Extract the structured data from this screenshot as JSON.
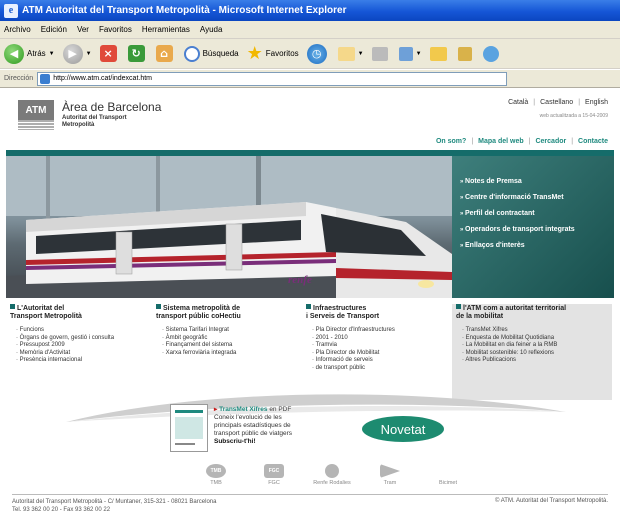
{
  "window": {
    "title": "ATM Autoritat del Transport Metropolità - Microsoft Internet Explorer"
  },
  "menu": [
    "Archivo",
    "Edición",
    "Ver",
    "Favoritos",
    "Herramientas",
    "Ayuda"
  ],
  "toolbar": {
    "back_label": "Atrás",
    "search_label": "Búsqueda",
    "favorites_label": "Favoritos"
  },
  "address": {
    "label": "Dirección",
    "url": "http://www.atm.cat/indexcat.htm"
  },
  "header": {
    "logo": "ATM",
    "title": "Àrea de Barcelona",
    "subtitle_line1": "Autoritat del Transport",
    "subtitle_line2": "Metropolità",
    "languages": [
      "Català",
      "Castellano",
      "English"
    ],
    "updated": "web actualitzada a 15-04-2009",
    "nav": [
      "On som?",
      "Mapa del web",
      "Cercador",
      "Contacte"
    ]
  },
  "hero": {
    "train_brand": "renfe",
    "links": [
      "Notes de Premsa",
      "Centre d'informació TransMet",
      "Perfil del contractant",
      "Operadors de transport integrats",
      "Enllaços d'interès"
    ]
  },
  "columns": [
    {
      "title_line1": "L'Autoritat del",
      "title_line2": "Transport Metropolità",
      "items": [
        "Funcions",
        "Òrgans de govern, gestió i consulta",
        "Pressupost 2009",
        "Memòria d'Activitat",
        "Presència internacional"
      ]
    },
    {
      "title_line1": "Sistema metropolità de",
      "title_line2": "transport públic coHectiu",
      "items": [
        "Sistema Tarifari Integrat",
        "Àmbit geogràfic",
        "Finançament del sistema",
        "Xarxa ferroviària integrada"
      ]
    },
    {
      "title_line1": "Infraestructures",
      "title_line2": "i Serveis de Transport",
      "items": [
        "Pla Director d'Infraestructures",
        "2001 - 2010",
        "Tramvia",
        "Pla Director de Mobilitat",
        "Informació de serveis",
        "de transport públic"
      ]
    },
    {
      "title_line1": "l'ATM com a autoritat territorial",
      "title_line2": "de la mobilitat",
      "items": [
        "TransMet Xifres",
        "Enquesta de Mobilitat Quotidiana",
        "La Mobilitat en dia feiner a la RMB",
        "Mobilitat sostenible: 10 reflexions",
        "Altres Publicacions"
      ]
    }
  ],
  "promo": {
    "title": "TransMet Xifres",
    "title_suffix": "en PDF",
    "line1": "Coneix l'evolució de les",
    "line2": "principals estadístiques de",
    "line3": "transport públic de viatgers",
    "cta": "Subscriu-t'hi!",
    "badge": "Novetat"
  },
  "partners": [
    {
      "logo": "TMB",
      "name": "TMB"
    },
    {
      "logo": "FGC",
      "name": "FGC"
    },
    {
      "logo": "",
      "name": "Renfe Rodalies"
    },
    {
      "logo": "",
      "name": "Tram"
    },
    {
      "logo": "",
      "name": "Bicimet"
    }
  ],
  "footer": {
    "address": "Autoritat del Transport Metropolità - C/ Muntaner, 315-321 - 08021 Barcelona",
    "phone": "Tel. 93 362 00 20 - Fax 93 362 00 22",
    "copyright": "© ATM. Autoritat del Transport Metropolità."
  },
  "colors": {
    "brand_teal": "#156c6a",
    "link_teal": "#1f8a7f",
    "titlebar_blue": "#1556d6"
  }
}
